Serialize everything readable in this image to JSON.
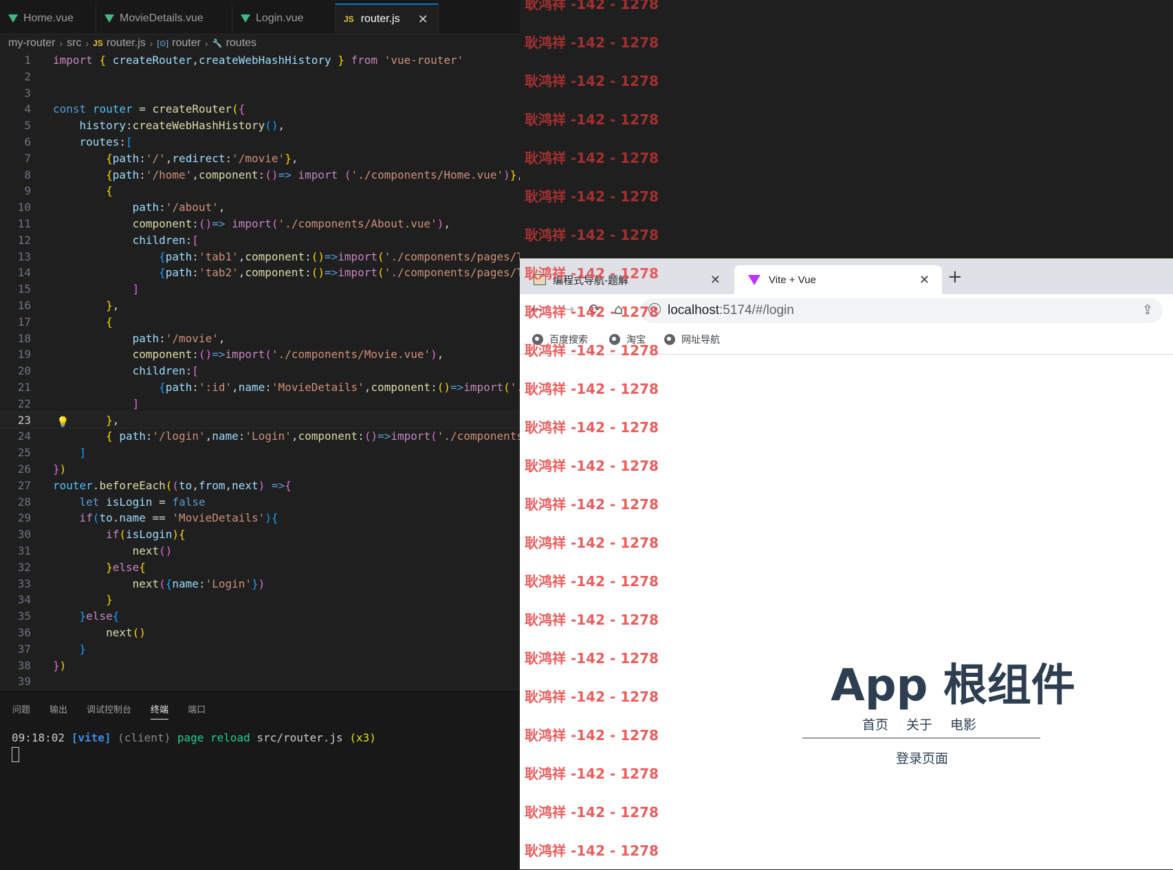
{
  "editor": {
    "tabs": [
      {
        "label": "Home.vue",
        "icon": "vue-icon"
      },
      {
        "label": "MovieDetails.vue",
        "icon": "vue-icon"
      },
      {
        "label": "Login.vue",
        "icon": "vue-icon"
      },
      {
        "label": "router.js",
        "icon": "js-icon",
        "active": true
      }
    ],
    "breadcrumb": [
      "my-router",
      "src",
      "router.js",
      "router",
      "routes"
    ],
    "js_badge": "JS",
    "current_line": 23
  },
  "panel": {
    "tabs": [
      "问题",
      "输出",
      "调试控制台",
      "终端",
      "端口"
    ],
    "active_tab": "终端",
    "terminal": {
      "time": "09:18:02",
      "tag": "[vite]",
      "source": "(client)",
      "action": "page reload",
      "file": "src/router.js",
      "count": "(x3)"
    }
  },
  "watermark": "耿鸿祥 -142 - 1278",
  "browser": {
    "tabs": [
      {
        "label": "编程式导航-题解",
        "active": false
      },
      {
        "label": "Vite + Vue",
        "active": true
      }
    ],
    "url_host": "localhost",
    "url_rest": ":5174/#/login",
    "bookmarks": [
      "百度搜索",
      "淘宝",
      "网址导航"
    ],
    "app": {
      "title": "App 根组件",
      "nav": [
        "首页",
        "关于",
        "电影"
      ],
      "view_text": "登录页面"
    }
  },
  "colors": {
    "accent": "#0078d4",
    "vue_green": "#42b883",
    "watermark_red": "#e84c4c",
    "app_text": "#2c3e50"
  }
}
